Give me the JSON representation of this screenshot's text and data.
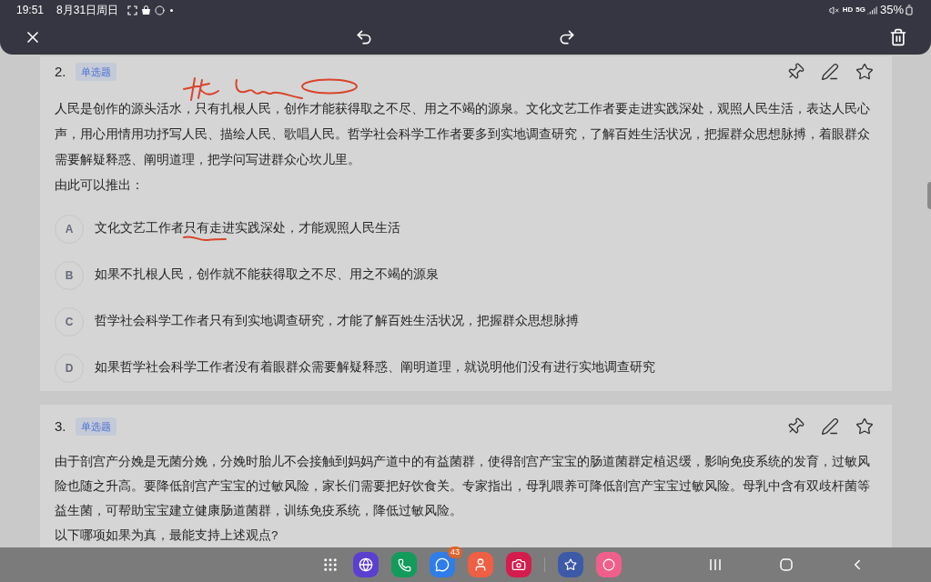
{
  "status_bar": {
    "time": "19:51",
    "date": "8月31日周日",
    "hd": "HD",
    "network": "5G",
    "battery": "35%"
  },
  "questions": [
    {
      "number": "2.",
      "type_tag": "单选题",
      "stem": "人民是创作的源头活水，只有扎根人民，创作才能获得取之不尽、用之不竭的源泉。文化文艺工作者要走进实践深处，观照人民生活，表达人民心声，用心用情用功抒写人民、描绘人民、歌唱人民。哲学社会科学工作者要多到实地调查研究，了解百姓生活状况，把握群众思想脉搏，着眼群众需要解疑释惑、阐明道理，把学问写进群众心坎儿里。",
      "prompt": "由此可以推出：",
      "annotated": true,
      "options": [
        {
          "letter": "A",
          "text": "文化文艺工作者只有走进实践深处，才能观照人民生活"
        },
        {
          "letter": "B",
          "text": "如果不扎根人民，创作就不能获得取之不尽、用之不竭的源泉"
        },
        {
          "letter": "C",
          "text": "哲学社会科学工作者只有到实地调查研究，才能了解百姓生活状况，把握群众思想脉搏"
        },
        {
          "letter": "D",
          "text": "如果哲学社会科学工作者没有着眼群众需要解疑释惑、阐明道理，就说明他们没有进行实地调查研究"
        }
      ]
    },
    {
      "number": "3.",
      "type_tag": "单选题",
      "stem": "由于剖宫产分娩是无菌分娩，分娩时胎儿不会接触到妈妈产道中的有益菌群，使得剖宫产宝宝的肠道菌群定植迟缓，影响免疫系统的发育，过敏风险也随之升高。要降低剖宫产宝宝的过敏风险，家长们需要把好饮食关。专家指出，母乳喂养可降低剖宫产宝宝过敏风险。母乳中含有双歧杆菌等益生菌，可帮助宝宝建立健康肠道菌群，训练免疫系统，降低过敏风险。",
      "prompt": "以下哪项如果为真，最能支持上述观点?",
      "annotated": false
    }
  ],
  "dock": {
    "messages_badge": "43"
  }
}
